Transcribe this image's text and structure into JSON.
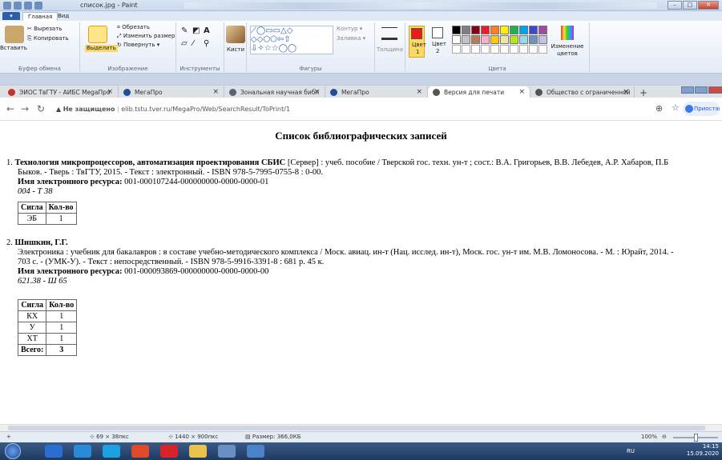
{
  "paint": {
    "title": "список.jpg - Paint",
    "file_tab": "",
    "tabs": [
      "Главная",
      "Вид"
    ],
    "clipboard": {
      "paste": "Вставить",
      "cut": "Вырезать",
      "copy": "Копировать",
      "label": "Буфер обмена"
    },
    "image": {
      "select": "Выделить",
      "crop": "Обрезать",
      "resize": "Изменить размер",
      "rotate": "Повернуть",
      "label": "Изображение"
    },
    "tools": {
      "text_tool": "A",
      "label": "Инструменты"
    },
    "brushes": "Кисти",
    "shapes": {
      "outline": "Контур",
      "fill": "Заливка",
      "label": "Фигуры"
    },
    "size": "Толщина",
    "color1": {
      "label": "Цвет",
      "num": "1"
    },
    "color2": {
      "label": "Цвет",
      "num": "2"
    },
    "edit_colors": "Изменение цветов",
    "colors_label": "Цвета",
    "palette": [
      "#000000",
      "#7f7f7f",
      "#880015",
      "#ed1c24",
      "#ff7f27",
      "#fff200",
      "#22b14c",
      "#00a2e8",
      "#3f48cc",
      "#a349a4",
      "#ffffff",
      "#c3c3c3",
      "#b97a57",
      "#ffaec9",
      "#ffc90e",
      "#efe4b0",
      "#b5e61d",
      "#99d9ea",
      "#7092be",
      "#c8bfe7"
    ],
    "accent_red": "#e81c1c"
  },
  "browser": {
    "tabs": [
      {
        "label": "ЭИОС ТвГТУ - АИБС MegaПро",
        "icon_color": "#c0392b"
      },
      {
        "label": "МегаПро",
        "icon_color": "#1e4f9c"
      },
      {
        "label": "Зональная научная библ",
        "icon_color": "#556677"
      },
      {
        "label": "МегаПро",
        "icon_color": "#1e4f9c"
      },
      {
        "label": "Версия для печати",
        "icon_color": "#555555"
      },
      {
        "label": "Общество с ограниченной",
        "icon_color": "#555555"
      }
    ],
    "security": "Не защищено",
    "url": "elib.tstu.tver.ru/MegaPro/Web/SearchResult/ToPrint/1",
    "profile": "Приостановлена"
  },
  "page": {
    "heading": "Список библиографических записей",
    "records": [
      {
        "num": "1.",
        "title_bold": "Технология микропроцессоров, автоматизация проектирования СБИС",
        "line1_rest": " [Сервер] : учеб. пособие / Тверской гос. техн. ун-т ; сост.: В.А. Григорьев, В.В. Лебедев, А.Р. Хабаров, П.Б",
        "line2": "Быков. - Тверь : ТвГТУ, 2015. - Текст : электронный. - ISBN 978-5-7995-0755-8 : 0-00.",
        "res_label": "Имя электронного ресурса:",
        "res_value": " 001-000107244-000000000-0000-0000-01",
        "shelf": "004 - Т 38",
        "headers": [
          "Сигла",
          "Кол-во"
        ],
        "rows": [
          [
            "ЭБ",
            "1"
          ]
        ]
      },
      {
        "num": "2.",
        "author_bold": "Шишкин, Г.Г.",
        "line1": "Электроника : учебник для бакалавров : в составе учебно-методического комплекса / Моск. авиац. ин-т (Нац. исслед. ин-т), Моск. гос. ун-т им. М.В. Ломоносова. - М. : Юрайт, 2014. -",
        "line2": "703 с. - (УМК-У). - Текст : непосредственный. - ISBN 978-5-9916-3391-8 : 681 р. 45 к.",
        "res_label": "Имя электронного ресурса:",
        "res_value": " 001-000093869-000000000-0000-0000-00",
        "shelf": "621.38 - Ш 65",
        "headers": [
          "Сигла",
          "Кол-во"
        ],
        "rows": [
          [
            "КХ",
            "1"
          ],
          [
            "У",
            "1"
          ],
          [
            "ХТ",
            "1"
          ]
        ],
        "total_label": "Всего:",
        "total_value": "3"
      }
    ]
  },
  "status": {
    "cursor_pos": "69 × 38пкс",
    "dimensions": "1440 × 900пкс",
    "file_size": "Размер: 366,0КБ",
    "zoom": "100%"
  },
  "taskbar": {
    "lang": "RU",
    "time": "14:15",
    "date": "15.09.2020"
  }
}
